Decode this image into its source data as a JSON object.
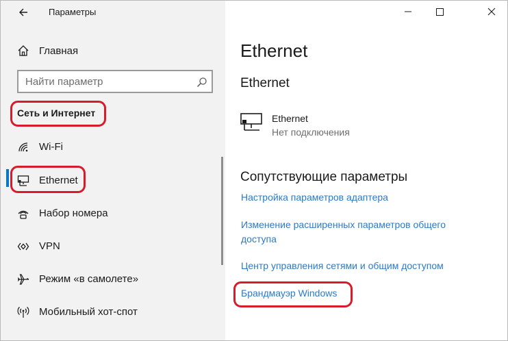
{
  "window": {
    "title": "Параметры",
    "controls": [
      "minimize",
      "maximize",
      "close"
    ]
  },
  "sidebar": {
    "home_label": "Главная",
    "search": {
      "placeholder": "Найти параметр"
    },
    "section_header": "Сеть и Интернет",
    "items": [
      {
        "label": "Wi-Fi",
        "icon": "wifi-icon"
      },
      {
        "label": "Ethernet",
        "icon": "ethernet-icon",
        "selected": true
      },
      {
        "label": "Набор номера",
        "icon": "dialup-icon"
      },
      {
        "label": "VPN",
        "icon": "vpn-icon"
      },
      {
        "label": "Режим «в самолете»",
        "icon": "airplane-icon"
      },
      {
        "label": "Мобильный хот-спот",
        "icon": "hotspot-icon"
      }
    ]
  },
  "main": {
    "page_title": "Ethernet",
    "section_title": "Ethernet",
    "connection": {
      "name": "Ethernet",
      "status": "Нет подключения"
    },
    "related_title": "Сопутствующие параметры",
    "links": [
      "Настройка параметров адаптера",
      "Изменение расширенных параметров общего доступа",
      "Центр управления сетями и общим доступом",
      "Брандмауэр Windows"
    ]
  },
  "colors": {
    "accent": "#0078d7",
    "link": "#2a7ac8",
    "highlight_outline": "#d61b2b",
    "sidebar_bg": "#f2f2f2"
  }
}
